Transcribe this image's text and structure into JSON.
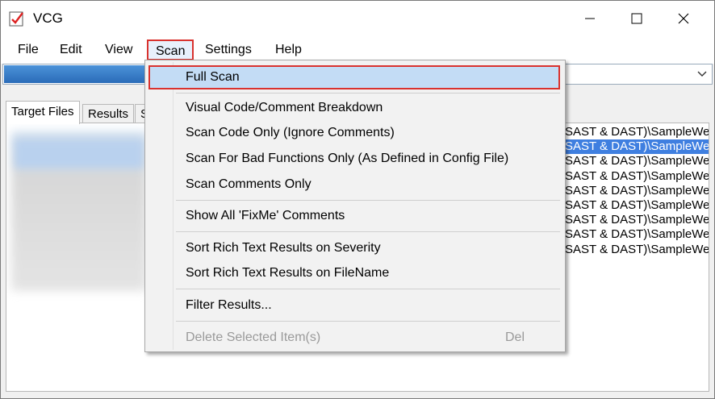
{
  "window": {
    "title": "VCG"
  },
  "menubar": {
    "file": "File",
    "edit": "Edit",
    "view": "View",
    "scan": "Scan",
    "settings": "Settings",
    "help": "Help"
  },
  "tabs": {
    "target": "Target Files",
    "results": "Results",
    "third": "S"
  },
  "scan_menu": {
    "items": [
      {
        "label": "Full Scan"
      },
      {
        "label": "Visual Code/Comment Breakdown"
      },
      {
        "label": "Scan Code Only (Ignore Comments)"
      },
      {
        "label": "Scan For Bad Functions Only (As Defined in Config File)"
      },
      {
        "label": "Scan Comments Only"
      },
      {
        "label": "Show All 'FixMe' Comments"
      },
      {
        "label": "Sort Rich Text Results on Severity"
      },
      {
        "label": "Sort Rich Text Results on FileName"
      },
      {
        "label": "Filter Results..."
      },
      {
        "label": "Delete Selected Item(s)",
        "shortcut": "Del",
        "disabled": true
      }
    ]
  },
  "file_list": {
    "lines": [
      "SAST & DAST)\\SampleWe",
      "SAST & DAST)\\SampleWe",
      "SAST & DAST)\\SampleWe",
      "SAST & DAST)\\SampleWe",
      "SAST & DAST)\\SampleWe",
      "SAST & DAST)\\SampleWe",
      "SAST & DAST)\\SampleWe",
      "SAST & DAST)\\SampleWe",
      "SAST & DAST)\\SampleWe"
    ],
    "selected_index": 1
  },
  "colors": {
    "highlight_outline": "#d9322e",
    "selection": "#3f7fe0",
    "menu_hover": "#c3dcf5"
  }
}
